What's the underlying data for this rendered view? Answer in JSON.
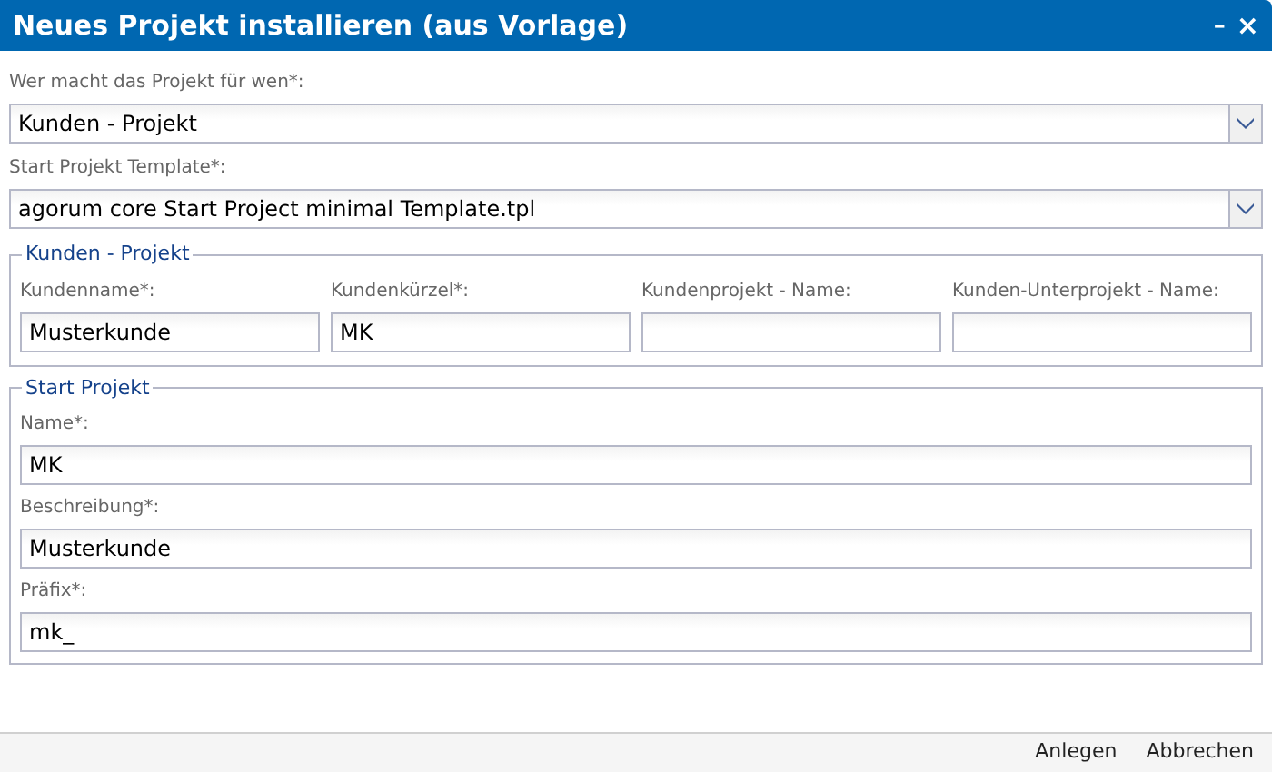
{
  "window": {
    "title": "Neues Projekt installieren (aus Vorlage)",
    "controls": [
      "–",
      "×"
    ]
  },
  "selects": [
    {
      "label": "Wer macht das Projekt für wen*:",
      "value": "Kunden - Projekt"
    },
    {
      "label": "Start Projekt Template*:",
      "value": "agorum core Start Project minimal Template.tpl"
    }
  ],
  "customer_group": {
    "legend": "Kunden - Projekt",
    "fields": [
      {
        "label": "Kundenname*:",
        "value": "Musterkunde"
      },
      {
        "label": "Kundenkürzel*:",
        "value": "MK"
      },
      {
        "label": "Kundenprojekt - Name:"
      },
      {
        "label": "Kunden-Unterprojekt - Name:"
      }
    ]
  },
  "project_group": {
    "legend": "Start Projekt",
    "fields": [
      {
        "label": "Name*:",
        "value": "MK"
      },
      {
        "label": "Beschreibung*:",
        "value": "Musterkunde"
      },
      {
        "label": "Präfix*:",
        "value": "mk_"
      }
    ]
  },
  "buttons": [
    "Anlegen",
    "Abbrechen"
  ]
}
